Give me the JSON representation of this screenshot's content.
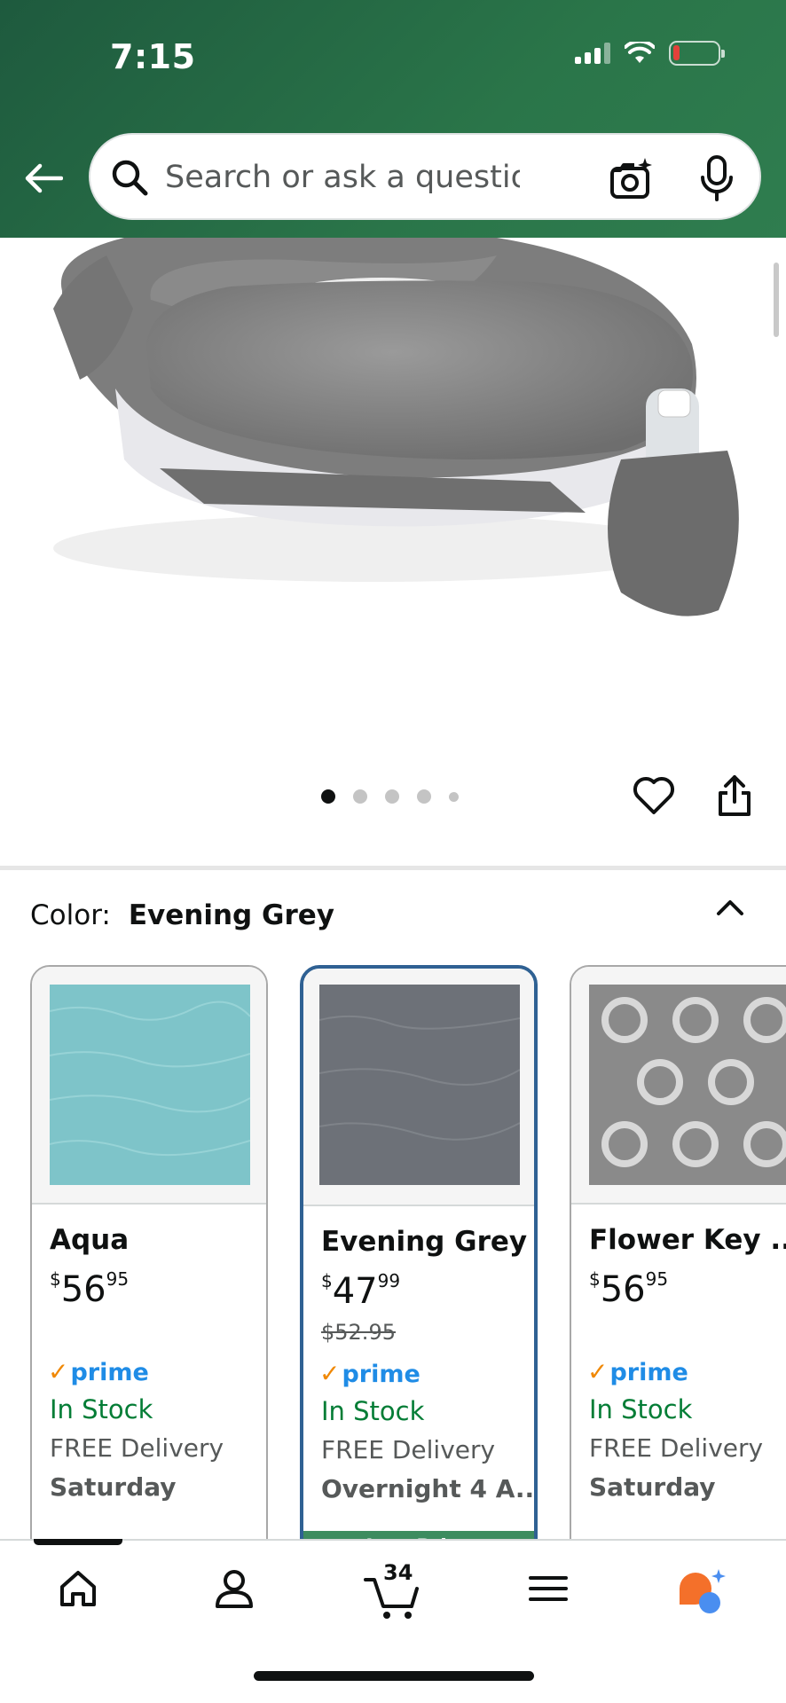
{
  "status_bar": {
    "time": "7:15"
  },
  "search": {
    "placeholder": "Search or ask a question"
  },
  "carousel": {
    "dot_count": 5,
    "active_index": 0
  },
  "color_selector": {
    "label": "Color:",
    "selected": "Evening Grey"
  },
  "swatches": [
    {
      "name": "Aqua",
      "price_symbol": "$",
      "price_whole": "56",
      "price_fraction": "95",
      "old_price": "",
      "prime": "prime",
      "stock": "In Stock",
      "delivery": "FREE Delivery",
      "delivery_day": "Saturday",
      "selected": false
    },
    {
      "name": "Evening Grey",
      "price_symbol": "$",
      "price_whole": "47",
      "price_fraction": "99",
      "old_price": "$52.95",
      "prime": "prime",
      "stock": "In Stock",
      "delivery": "FREE Delivery",
      "delivery_day": "Overnight 4 A...",
      "banner": "Low Price",
      "selected": true
    },
    {
      "name": "Flower Key ...",
      "price_symbol": "$",
      "price_whole": "56",
      "price_fraction": "95",
      "old_price": "",
      "prime": "prime",
      "stock": "In Stock",
      "delivery": "FREE Delivery",
      "delivery_day": "Saturday",
      "selected": false
    }
  ],
  "bottom_nav": {
    "cart_count": "34"
  },
  "colors": {
    "header": "#2a7549",
    "selected_border": "#2f6193",
    "in_stock": "#047d36",
    "prime": "#1f8ce6"
  }
}
